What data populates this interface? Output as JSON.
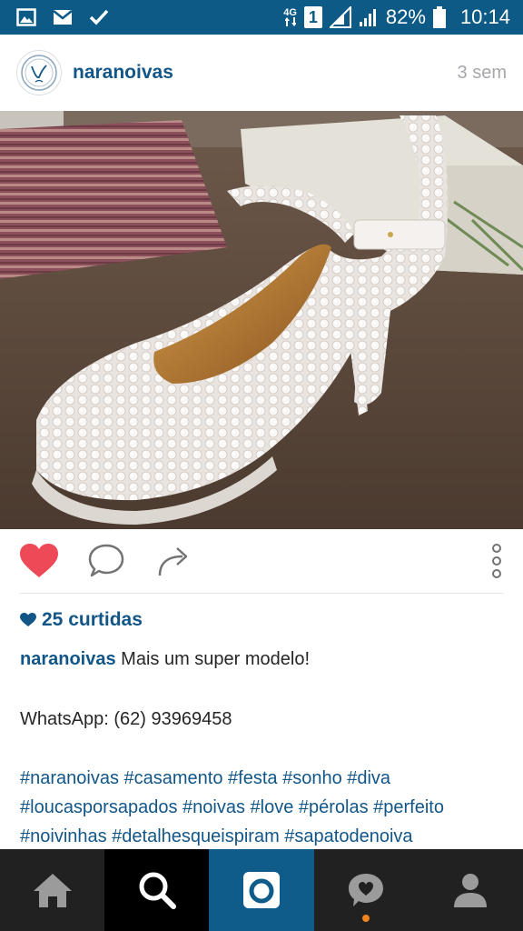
{
  "status_bar": {
    "network_type": "4G",
    "sim_slot": "1",
    "battery_percent": "82%",
    "time": "10:14",
    "left_icons": [
      "image-icon",
      "mail-icon",
      "check-icon"
    ],
    "bg_color": "#0c5a85"
  },
  "post": {
    "username": "naranoivas",
    "time_ago": "3 sem",
    "likes": "25 curtidas",
    "caption_user": "naranoivas",
    "caption_text": "Mais um super modelo!",
    "whatsapp": "WhatsApp: (62) 93969458",
    "hashtags_line1": "#naranoivas #casamento #festa #sonho #diva",
    "hashtags_line2": "#loucasporsapados #noivas #love #pérolas #perfeito",
    "hashtags_line3": "#noivinhas #detalhesqueispiram #sapatodenoiva",
    "photo_description_icon": "pearl-shoe-photo"
  },
  "actions": {
    "like_icon": "heart-filled-icon",
    "comment_icon": "comment-icon",
    "share_icon": "share-icon",
    "more_icon": "more-vertical-icon",
    "liked_color": "#ed4956"
  },
  "bottom_nav": {
    "items": [
      "home-icon",
      "search-icon",
      "camera-icon",
      "activity-icon",
      "profile-icon"
    ],
    "active": "search",
    "camera_bg": "#0f5c8a"
  },
  "colors": {
    "link_blue": "#125688",
    "muted": "#a5a7aa"
  }
}
